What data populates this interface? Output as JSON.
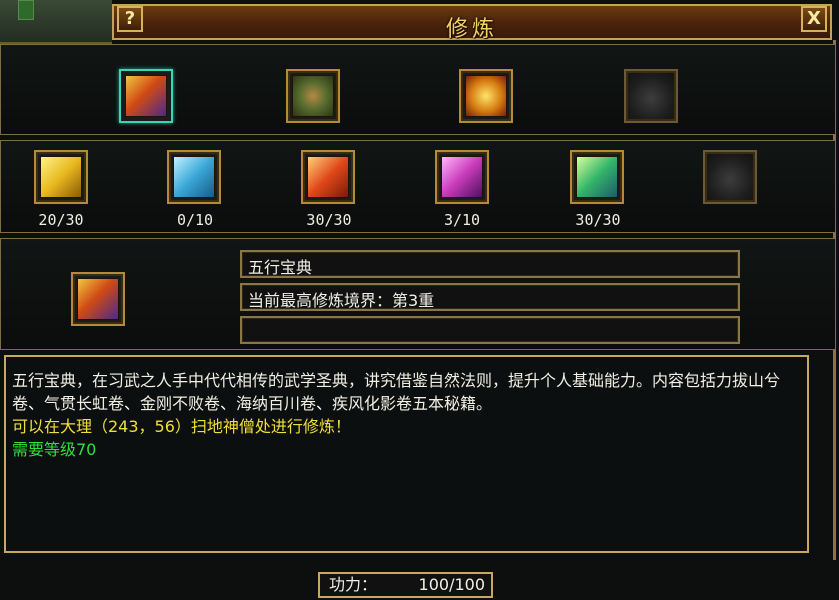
{
  "window": {
    "title": "修炼"
  },
  "help_button": {
    "label": "?"
  },
  "close_button": {
    "label": "X"
  },
  "top_slots": [
    {
      "icon": "book-red"
    },
    {
      "icon": "scroll-bundle"
    },
    {
      "icon": "gold-bundle"
    },
    {
      "icon": "empty"
    }
  ],
  "skill_books": [
    {
      "icon": "book-yellow",
      "progress": "20/30"
    },
    {
      "icon": "book-blue",
      "progress": "0/10"
    },
    {
      "icon": "book-orange",
      "progress": "30/30"
    },
    {
      "icon": "book-purple",
      "progress": "3/10"
    },
    {
      "icon": "book-green",
      "progress": "30/30"
    },
    {
      "icon": "empty",
      "progress": ""
    }
  ],
  "selected": {
    "icon": "book-red",
    "name": "五行宝典",
    "realm": "当前最高修炼境界：第3重",
    "extra": ""
  },
  "description": {
    "body": "五行宝典，在习武之人手中代代相传的武学圣典，讲究借鉴自然法则，提升个人基础能力。内容包括力拔山兮卷、气贯长虹卷、金刚不败卷、海纳百川卷、疾风化影卷五本秘籍。",
    "location": "可以在大理（243，56）扫地神僧处进行修炼！",
    "requirement": "需要等级70"
  },
  "power": {
    "label": "功力：",
    "value": "100/100"
  },
  "colors": {
    "accent_gold": "#c7a85e",
    "title_text": "#f4d26a",
    "location_text": "#f2df36",
    "requirement_text": "#2fe03a"
  }
}
